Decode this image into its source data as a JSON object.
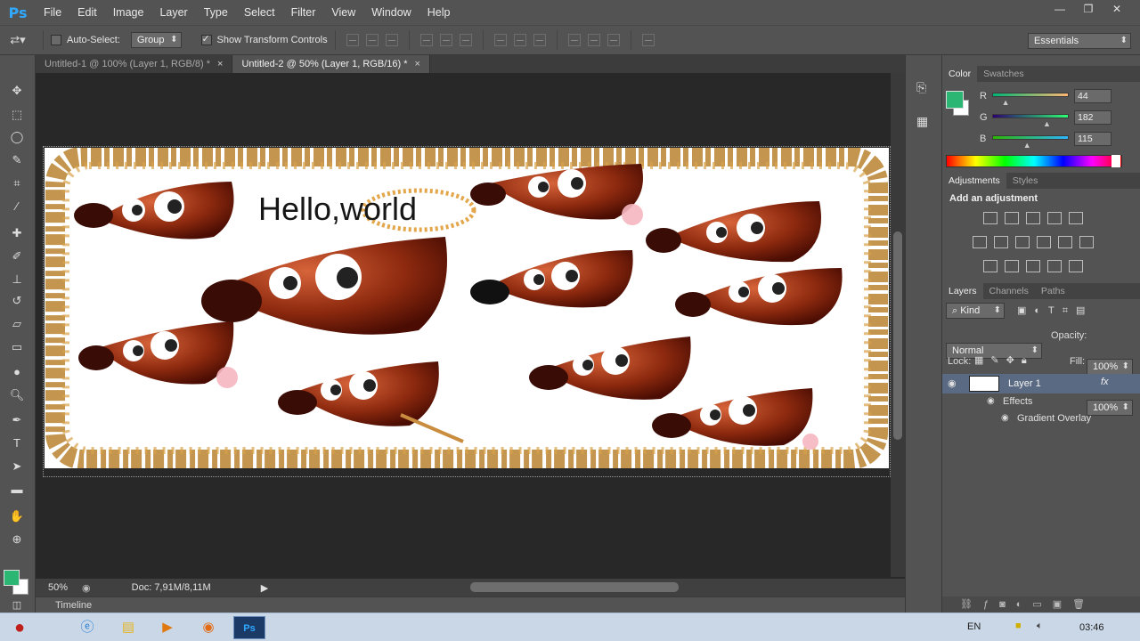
{
  "app": {
    "logo": "Ps"
  },
  "menu": [
    "File",
    "Edit",
    "Image",
    "Layer",
    "Type",
    "Select",
    "Filter",
    "View",
    "Window",
    "Help"
  ],
  "window_controls": {
    "minimize": "—",
    "restore": "❐",
    "close": "✕"
  },
  "options": {
    "auto_select_label": "Auto-Select:",
    "auto_select_checked": false,
    "group_value": "Group",
    "show_transform_label": "Show Transform Controls",
    "show_transform_checked": true,
    "workspace": "Essentials"
  },
  "tabs": [
    {
      "label": "Untitled-1 @ 100% (Layer 1, RGB/8) *",
      "active": false,
      "close": "×"
    },
    {
      "label": "Untitled-2 @ 50% (Layer 1, RGB/16) *",
      "active": true,
      "close": "×"
    }
  ],
  "canvas": {
    "text": "Hello,world"
  },
  "status": {
    "zoom": "50%",
    "doc": "Doc: 7,91M/8,11M"
  },
  "timeline_label": "Timeline",
  "color_panel": {
    "tabs": [
      "Color",
      "Swatches"
    ],
    "channels": [
      {
        "label": "R",
        "value": "44",
        "fraction": 0.17
      },
      {
        "label": "G",
        "value": "182",
        "fraction": 0.71
      },
      {
        "label": "B",
        "value": "115",
        "fraction": 0.45
      }
    ],
    "foreground": "#2cb673"
  },
  "adjustments_panel": {
    "tabs": [
      "Adjustments",
      "Styles"
    ],
    "title": "Add an adjustment"
  },
  "layers_panel": {
    "tabs": [
      "Layers",
      "Channels",
      "Paths"
    ],
    "kind": "Kind",
    "blend_mode": "Normal",
    "opacity_label": "Opacity:",
    "opacity": "100%",
    "lock_label": "Lock:",
    "fill_label": "Fill:",
    "fill": "100%",
    "layer": {
      "name": "Layer 1",
      "fx": "fx",
      "effects": "Effects",
      "effect_item": "Gradient Overlay"
    }
  },
  "taskbar": {
    "lang": "EN",
    "time": "03:46"
  }
}
